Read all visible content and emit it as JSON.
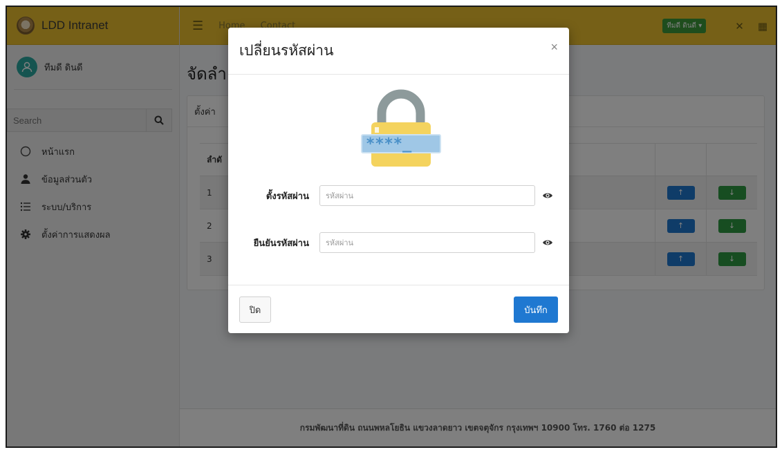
{
  "brand": {
    "title": "LDD Intranet"
  },
  "user": {
    "name": "ทีมดี ดินดี"
  },
  "sidebar": {
    "search_placeholder": "Search",
    "items": [
      {
        "label": "หน้าแรก",
        "icon": "circle-icon"
      },
      {
        "label": "ข้อมูลส่วนตัว",
        "icon": "user-icon"
      },
      {
        "label": "ระบบ/บริการ",
        "icon": "list-icon"
      },
      {
        "label": "ตั้งค่าการแสดงผล",
        "icon": "gear-icon"
      }
    ]
  },
  "topbar": {
    "links": [
      "Home",
      "Contact"
    ],
    "user_badge": "ทีมดี ดินดี ▾"
  },
  "page": {
    "title": "จัดลำ",
    "card_header": "ตั้งค่า",
    "table_head": "ลำดั",
    "rows": [
      "1",
      "2",
      "3"
    ]
  },
  "footer": {
    "text": "กรมพัฒนาที่ดิน ถนนพหลโยธิน แขวงลาดยาว เขตจตุจักร กรุงเทพฯ 10900 โทร. 1760 ต่อ 1275"
  },
  "modal": {
    "title": "เปลี่ยนรหัสผ่าน",
    "close_symbol": "×",
    "lock_text": "****_",
    "fields": [
      {
        "label": "ตั้งรหัสผ่าน",
        "placeholder": "รหัสผ่าน"
      },
      {
        "label": "ยืนยันรหัสผ่าน",
        "placeholder": "รหัสผ่าน"
      }
    ],
    "close_button": "ปิด",
    "save_button": "บันทึก"
  },
  "colors": {
    "header_yellow": "#ecc12f",
    "primary_blue": "#1f78d1",
    "success_green": "#2e9a43"
  }
}
